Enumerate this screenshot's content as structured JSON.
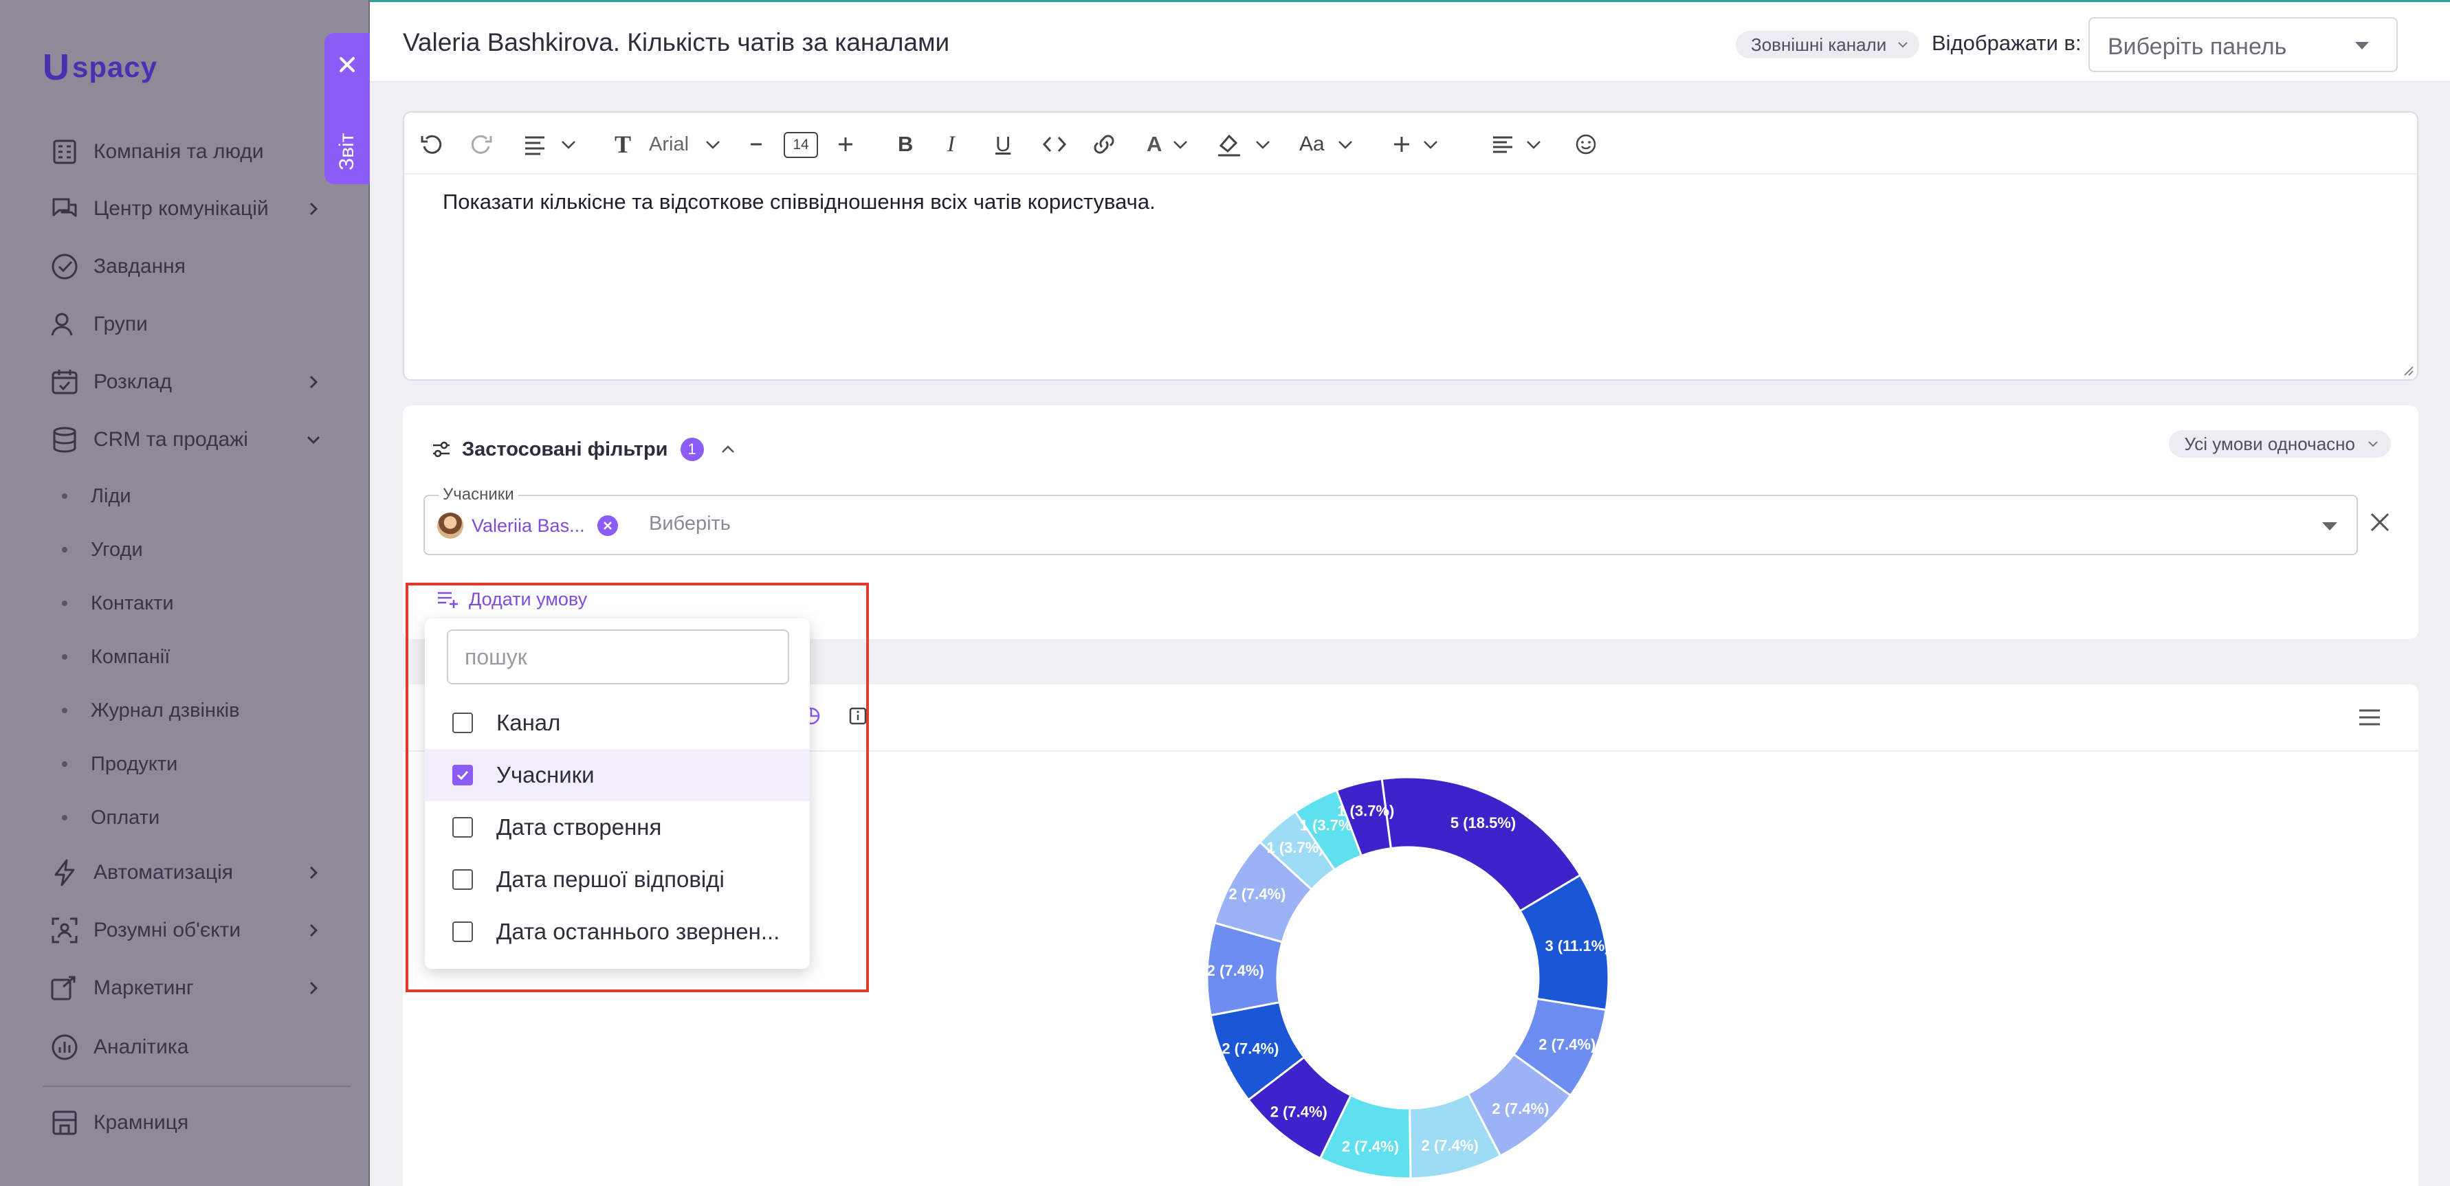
{
  "sidebar": {
    "logo": "spacy",
    "items": [
      {
        "label": "Компанія та люди",
        "icon": "building-icon"
      },
      {
        "label": "Центр комунікацій",
        "icon": "chat-icon"
      },
      {
        "label": "Завдання",
        "icon": "task-check-icon"
      },
      {
        "label": "Групи",
        "icon": "users-icon"
      },
      {
        "label": "Розклад",
        "icon": "calendar-icon"
      },
      {
        "label": "CRM та продажі",
        "icon": "database-icon"
      },
      {
        "label": "Автоматизація",
        "icon": "lightning-icon"
      },
      {
        "label": "Розумні об'єкти",
        "icon": "smart-object-icon"
      },
      {
        "label": "Маркетинг",
        "icon": "megaphone-icon"
      },
      {
        "label": "Аналітика",
        "icon": "analytics-icon"
      },
      {
        "label": "Крамниця",
        "icon": "store-icon"
      }
    ],
    "crm_sub": [
      "Ліди",
      "Угоди",
      "Контакти",
      "Компанії",
      "Журнал дзвінків",
      "Продукти",
      "Оплати"
    ]
  },
  "report_tab": {
    "label": "Звіт"
  },
  "header": {
    "title": "Valeria Bashkirova. Кількість чатів за каналами",
    "channels_badge": "Зовнішні канали",
    "display_in_label": "Відображати в:",
    "panel_placeholder": "Виберіть панель"
  },
  "editor": {
    "font": "Arial",
    "font_size": "14",
    "text": "Показати кількісне та відсоткове співвідношення всіх чатів користувача."
  },
  "filters": {
    "title": "Застосовані фільтри",
    "count": "1",
    "mode": "Усі умови одночасно",
    "participants_label": "Учасники",
    "participant_chip": "Valeriia Bas...",
    "participants_placeholder": "Виберіть",
    "add_condition": "Додати умову"
  },
  "dropdown": {
    "search_placeholder": "пошук",
    "options": [
      {
        "label": "Канал",
        "checked": false
      },
      {
        "label": "Учасники",
        "checked": true
      },
      {
        "label": "Дата створення",
        "checked": false
      },
      {
        "label": "Дата першої відповіді",
        "checked": false
      },
      {
        "label": "Дата останнього звернен...",
        "checked": false
      }
    ]
  },
  "chart_data": {
    "type": "pie",
    "donut": true,
    "slices": [
      {
        "value": 5,
        "label": "5 (18.5%)",
        "color": "#3d23c9"
      },
      {
        "value": 3,
        "label": "3 (11.1%)",
        "color": "#1a56d6"
      },
      {
        "value": 2,
        "label": "2 (7.4%)",
        "color": "#6d8ef0"
      },
      {
        "value": 2,
        "label": "2 (7.4%)",
        "color": "#9bb3f5"
      },
      {
        "value": 2,
        "label": "2 (7.4%)",
        "color": "#9edcf6"
      },
      {
        "value": 2,
        "label": "2 (7.4%)",
        "color": "#5fe0ee"
      },
      {
        "value": 2,
        "label": "2 (7.4%)",
        "color": "#3d23c9"
      },
      {
        "value": 2,
        "label": "2 (7.4%)",
        "color": "#1a56d6"
      },
      {
        "value": 2,
        "label": "2 (7.4%)",
        "color": "#6d8ef0"
      },
      {
        "value": 2,
        "label": "2 (7.4%)",
        "color": "#9bb3f5"
      },
      {
        "value": 1,
        "label": "1 (3.7%)",
        "color": "#9edcf6"
      },
      {
        "value": 1,
        "label": "1 (3.7%)",
        "color": "#5fe0ee"
      },
      {
        "value": 1,
        "label": "1 (3.7%)",
        "color": "#3d23c9"
      }
    ]
  },
  "colors": {
    "accent": "#8b5cf6",
    "highlight": "#e23b2e",
    "teal_top": "#28a69a"
  }
}
